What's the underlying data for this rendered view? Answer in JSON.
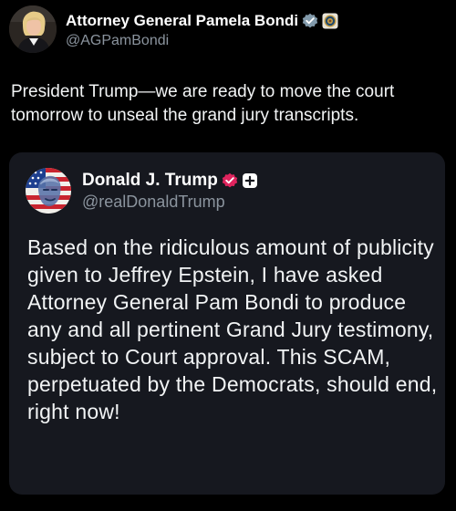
{
  "post": {
    "author": {
      "display_name": "Attorney General Pamela Bondi",
      "handle": "@AGPamBondi",
      "avatar_icon": "profile-photo",
      "verified_icon": "gray-check-badge-icon",
      "affiliate_icon": "doj-seal-icon"
    },
    "text": "President Trump—we are ready to move the court tomorrow to unseal the grand jury transcripts."
  },
  "quoted_post": {
    "author": {
      "display_name": "Donald J. Trump",
      "handle": "@realDonaldTrump",
      "avatar_icon": "flag-face-avatar",
      "verified_icon": "pink-check-badge-icon",
      "affiliate_icon": "plus-badge-icon"
    },
    "text": "Based on the ridiculous amount of publicity given to Jeffrey Epstein, I have asked Attorney General Pam Bondi to produce any and all pertinent Grand Jury testimony, subject to Court approval. This SCAM, perpetuated by the Democrats, should end, right now!"
  },
  "colors": {
    "background": "#000000",
    "card_background": "#16181f",
    "text_primary": "#f2f4f5",
    "text_secondary": "#8b949e",
    "verified_gray": "#829aab",
    "verified_pink": "#e0245e"
  }
}
